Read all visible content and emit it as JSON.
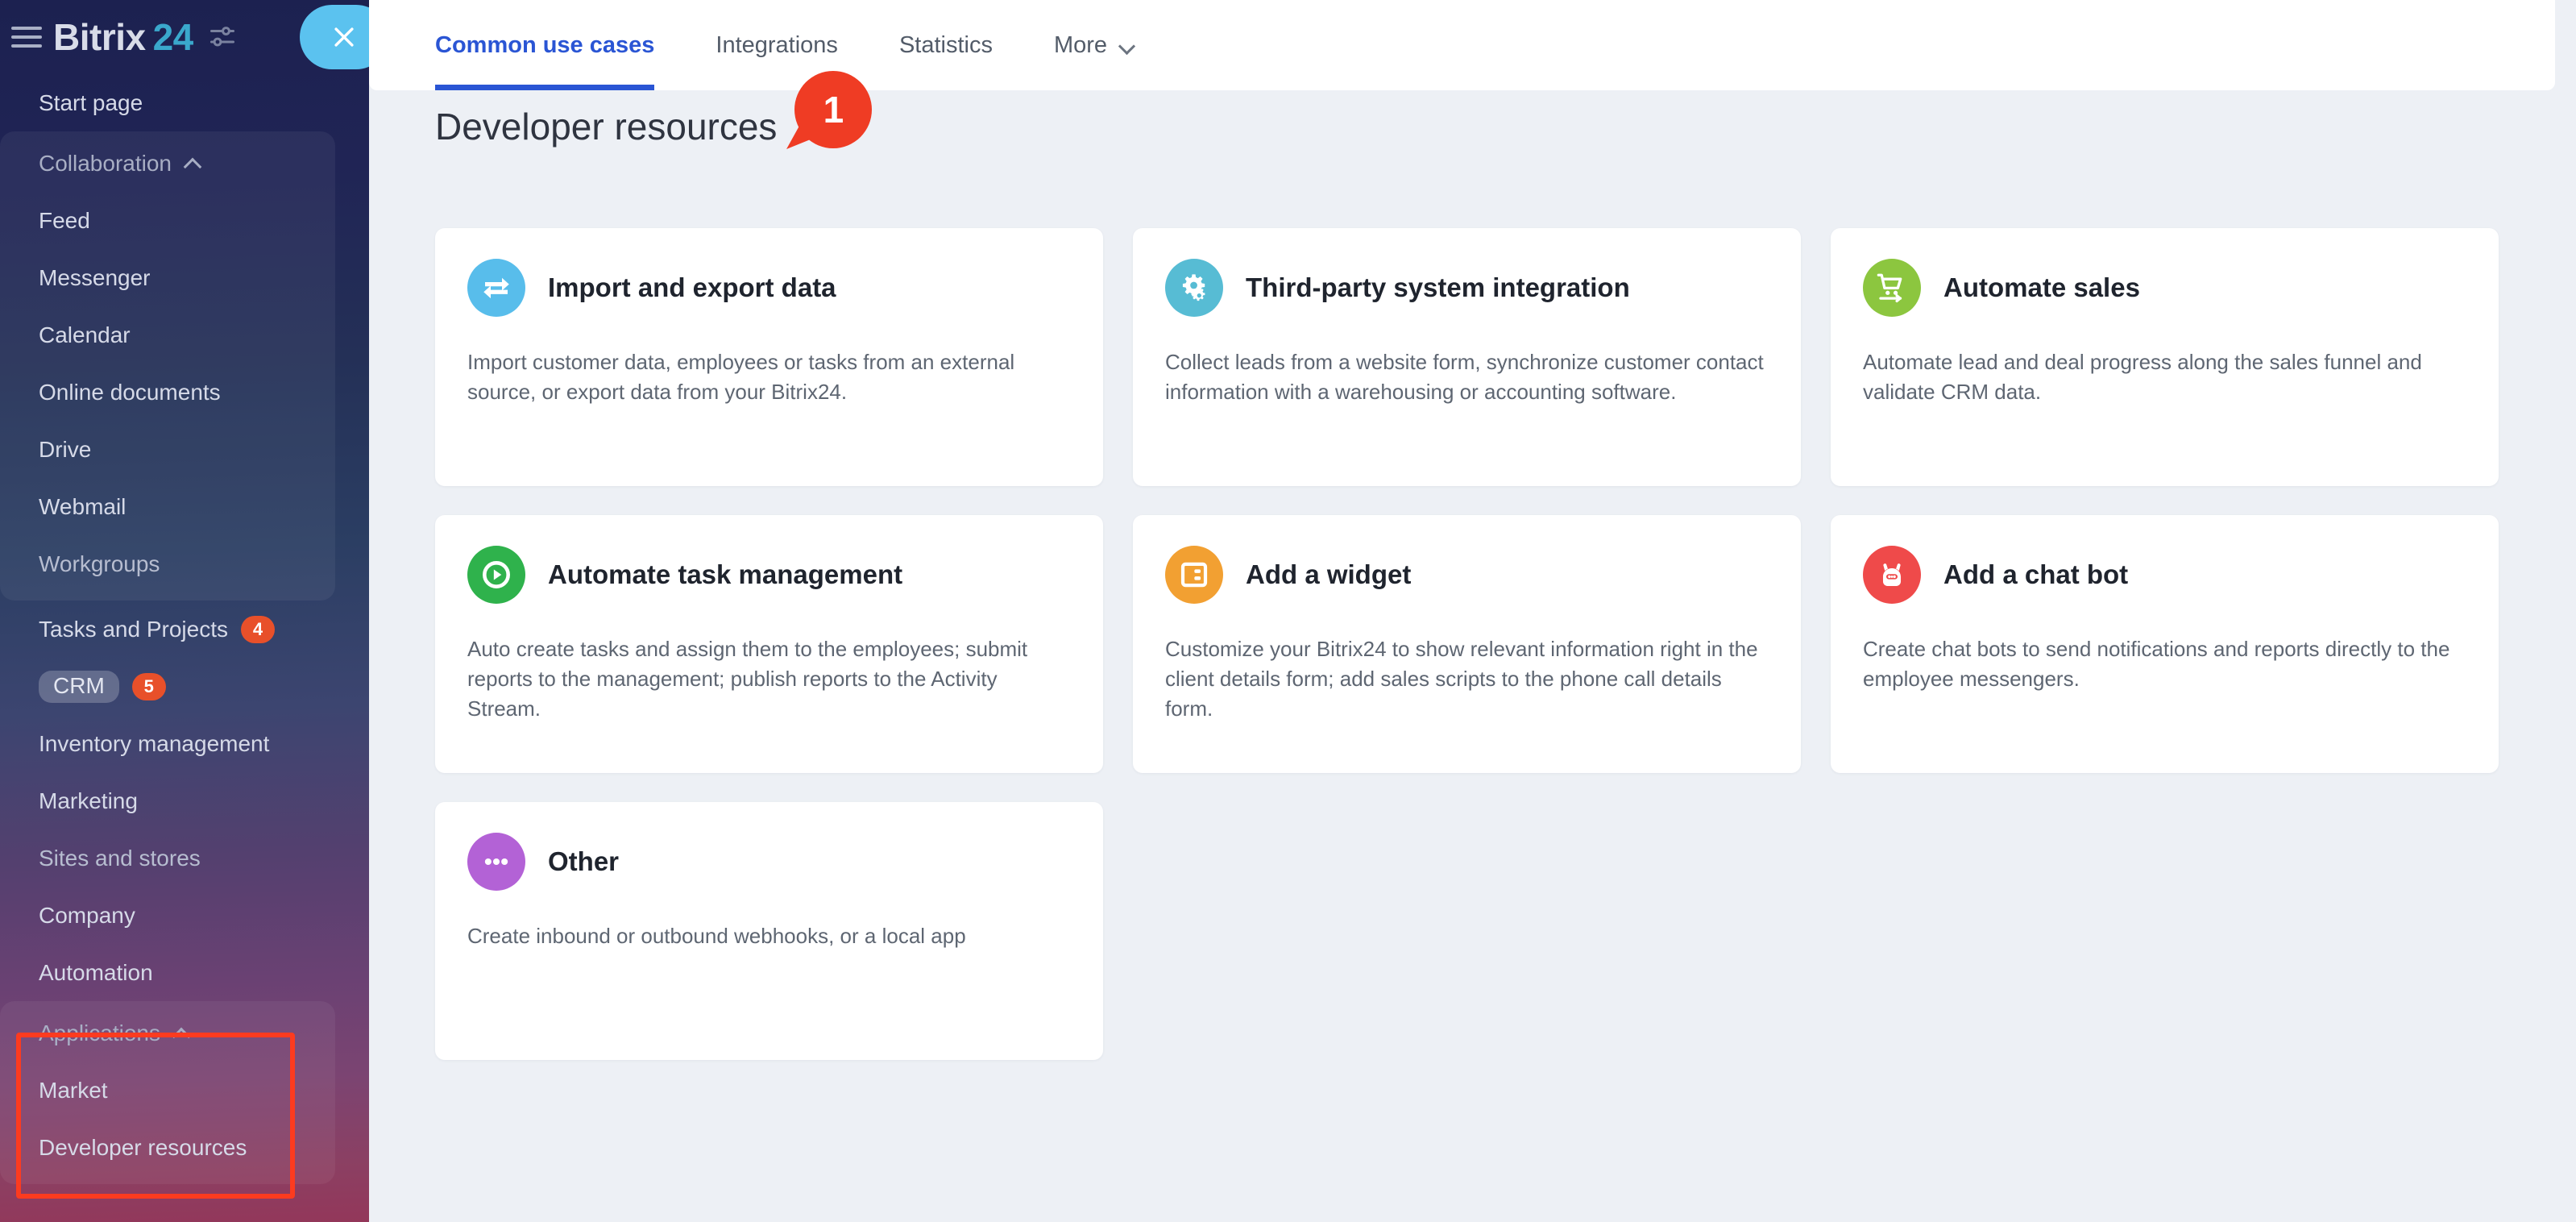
{
  "sidebar": {
    "logo": {
      "brand": "Bitrix",
      "number": "24",
      "settings_icon": "sliders-icon"
    },
    "close_label": "×",
    "items": [
      {
        "label": "Start page",
        "type": "item"
      },
      {
        "label": "Collaboration",
        "type": "group-header",
        "expanded": true
      },
      {
        "label": "Feed",
        "type": "sub"
      },
      {
        "label": "Messenger",
        "type": "sub"
      },
      {
        "label": "Calendar",
        "type": "sub"
      },
      {
        "label": "Online documents",
        "type": "sub"
      },
      {
        "label": "Drive",
        "type": "sub"
      },
      {
        "label": "Webmail",
        "type": "sub"
      },
      {
        "label": "Workgroups",
        "type": "sub"
      },
      {
        "label": "Tasks and Projects",
        "type": "item",
        "badge": "4"
      },
      {
        "label": "CRM",
        "type": "item-pill",
        "badge": "5"
      },
      {
        "label": "Inventory management",
        "type": "item"
      },
      {
        "label": "Marketing",
        "type": "item"
      },
      {
        "label": "Sites and stores",
        "type": "item"
      },
      {
        "label": "Company",
        "type": "item"
      },
      {
        "label": "Automation",
        "type": "item"
      },
      {
        "label": "Applications",
        "type": "group-header",
        "expanded": true
      },
      {
        "label": "Market",
        "type": "sub"
      },
      {
        "label": "Developer resources",
        "type": "sub"
      }
    ],
    "highlight_color": "#fc3b1f"
  },
  "tabs": [
    {
      "label": "Common use cases",
      "active": true
    },
    {
      "label": "Integrations",
      "active": false
    },
    {
      "label": "Statistics",
      "active": false
    },
    {
      "label": "More",
      "active": false,
      "has_dropdown": true
    }
  ],
  "page": {
    "title": "Developer resources",
    "marker_number": "1",
    "marker_color": "#ef3c24"
  },
  "cards": [
    {
      "title": "Import and export data",
      "desc": "Import customer data, employees or tasks from an external source, or export data from your Bitrix24.",
      "icon": "exchange-arrows-icon",
      "color": "#58bdeb"
    },
    {
      "title": "Third-party system integration",
      "desc": "Collect leads from a website form, synchronize customer contact information with a warehousing or accounting software.",
      "icon": "gears-icon",
      "color": "#57bcd4"
    },
    {
      "title": "Automate sales",
      "desc": "Automate lead and deal progress along the sales funnel and validate CRM data.",
      "icon": "shopping-cart-icon",
      "color": "#8cc63f"
    },
    {
      "title": "Automate task management",
      "desc": "Auto create tasks and assign them to the employees; submit reports to the management; publish reports to the Activity Stream.",
      "icon": "play-circle-icon",
      "color": "#2fb24c"
    },
    {
      "title": "Add a widget",
      "desc": "Customize your Bitrix24 to show relevant information right in the client details form; add sales scripts to the phone call details form.",
      "icon": "widget-panel-icon",
      "color": "#f2a032"
    },
    {
      "title": "Add a chat bot",
      "desc": "Create chat bots to send notifications and reports directly to the employee messengers.",
      "icon": "robot-icon",
      "color": "#ef4a4a"
    },
    {
      "title": "Other",
      "desc": "Create inbound or outbound webhooks, or a local app",
      "icon": "ellipsis-icon",
      "color": "#b362d6"
    }
  ]
}
